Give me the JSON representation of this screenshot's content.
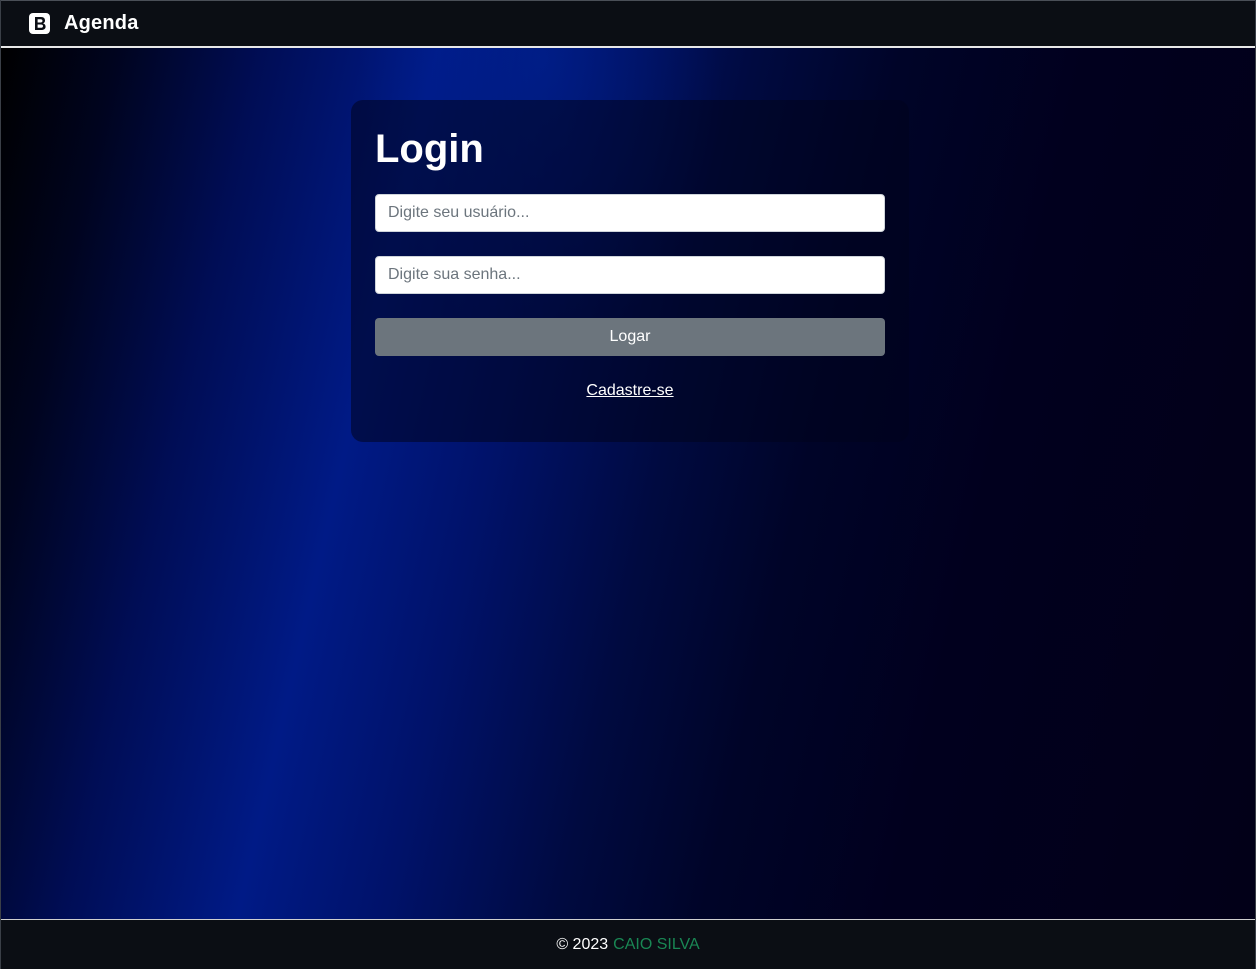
{
  "navbar": {
    "brand_icon": "bootstrap-icon",
    "brand_text": "Agenda"
  },
  "login": {
    "title": "Login",
    "username_placeholder": "Digite seu usuário...",
    "username_value": "",
    "password_placeholder": "Digite sua senha...",
    "password_value": "",
    "submit_label": "Logar",
    "register_link": "Cadastre-se"
  },
  "footer": {
    "copyright": "© 2023",
    "author": "CAIO SILVA",
    "author_color": "#198754"
  },
  "colors": {
    "navbar_bg": "#0b0e14",
    "button_bg": "#6c757d",
    "background_accent": "#001a86"
  }
}
